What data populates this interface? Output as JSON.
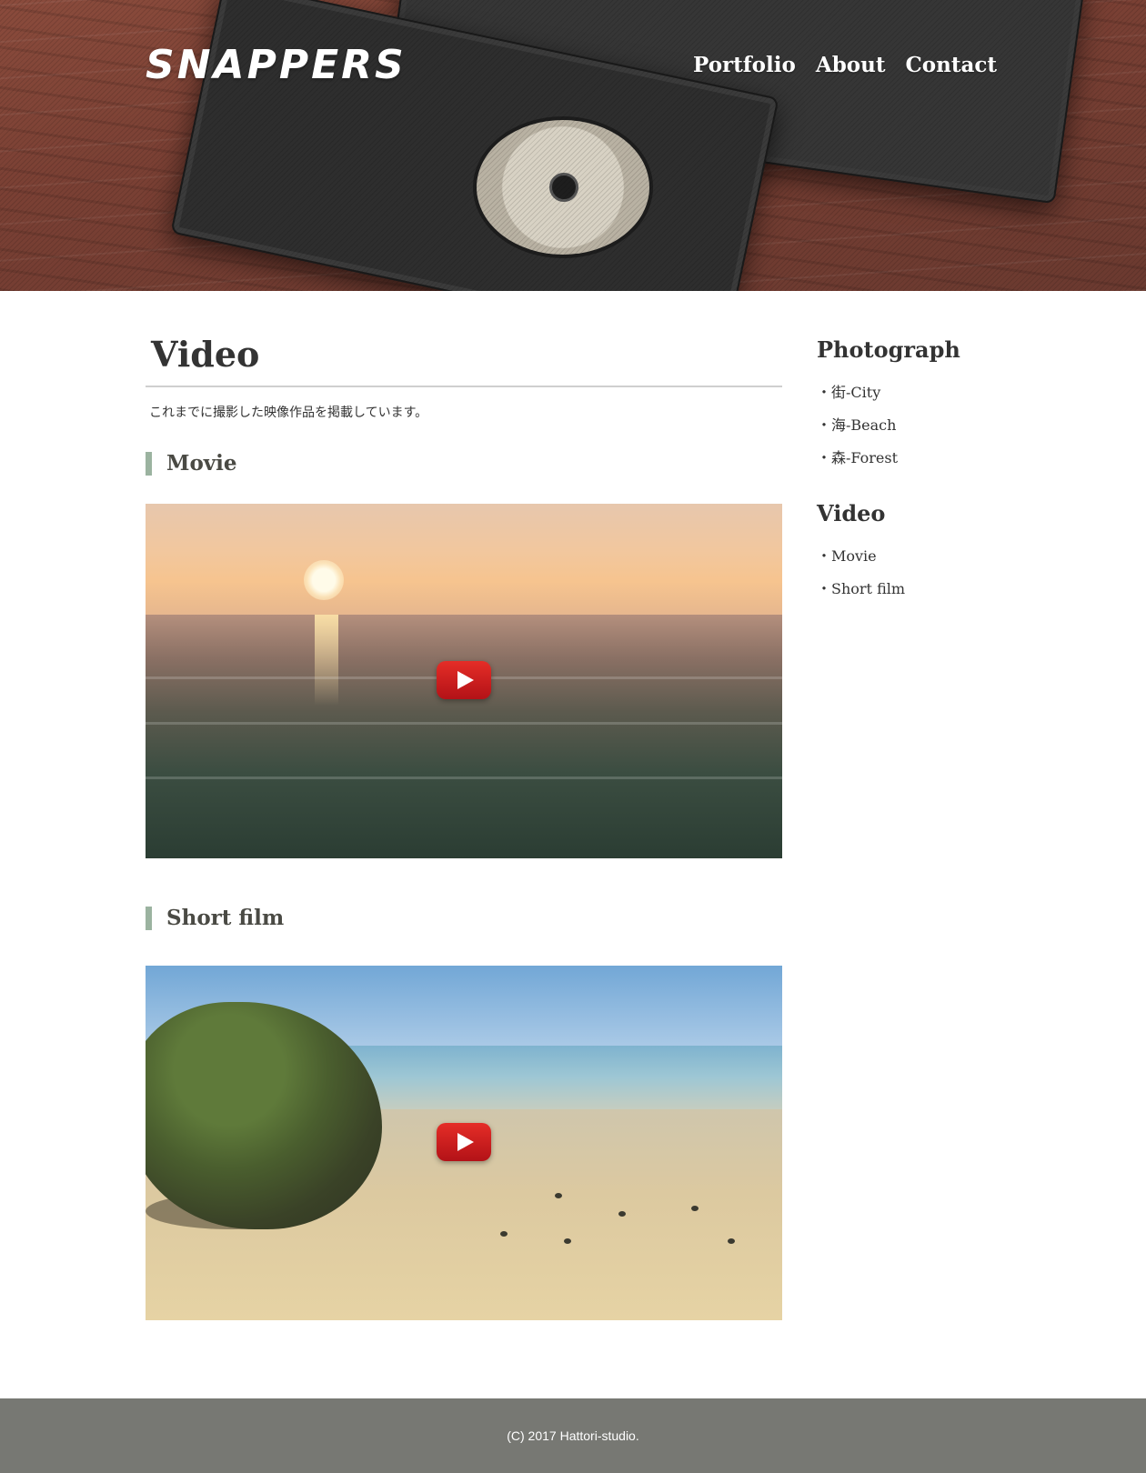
{
  "header": {
    "logo": "SNAPPERS",
    "nav": [
      "Portfolio",
      "About",
      "Contact"
    ]
  },
  "main": {
    "title": "Video",
    "lead": "これまでに撮影した映像作品を掲載しています。",
    "sections": [
      {
        "title": "Movie"
      },
      {
        "title": "Short film"
      }
    ]
  },
  "sidebar": {
    "groups": [
      {
        "title": "Photograph",
        "items": [
          "・街-City",
          "・海-Beach",
          "・森-Forest"
        ]
      },
      {
        "title": "Video",
        "items": [
          "・Movie",
          "・Short film"
        ]
      }
    ]
  },
  "footer": {
    "copyright": "(C) 2017 Hattori-studio."
  },
  "icons": {
    "play": "youtube-play-icon"
  },
  "colors": {
    "accent_bar": "#9bb3a0",
    "footer_bg": "#777873",
    "play_red": "#e52d27"
  }
}
